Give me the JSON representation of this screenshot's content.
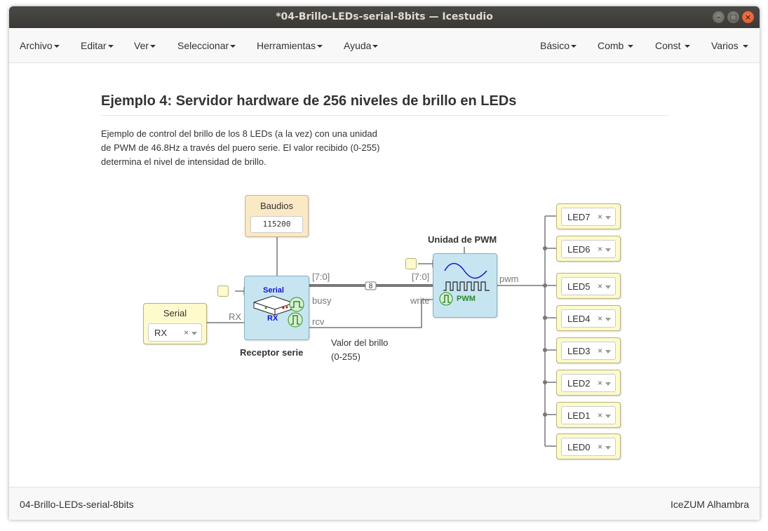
{
  "window": {
    "title": "*04-Brillo-LEDs-serial-8bits — Icestudio",
    "controls": [
      "–",
      "□",
      "×"
    ]
  },
  "menubar": {
    "left": [
      "Archivo",
      "Editar",
      "Ver",
      "Seleccionar",
      "Herramientas",
      "Ayuda"
    ],
    "right": [
      "Básico",
      "Comb",
      "Const",
      "Varios"
    ]
  },
  "canvas": {
    "heading": "Ejemplo 4: Servidor hardware de 256 niveles de brillo en LEDs",
    "description": [
      "Ejemplo de control del brillo de los 8 LEDs (a la vez) con una unidad",
      "de PWM de 46.8Hz a través del puero serie. El valor recibido (0-255)",
      "determina el nivel de intensidad de brillo."
    ],
    "constant": {
      "label": "Baudios",
      "value": "115200"
    },
    "serial_input": {
      "label": "Serial",
      "pin": "RX"
    },
    "receiver": {
      "title": "Serial",
      "subtitle": "RX",
      "caption": "Receptor serie",
      "in_port": "RX",
      "out_ports": {
        "data": "[7:0]",
        "busy": "busy",
        "rcv": "rcv"
      }
    },
    "pwm": {
      "caption": "Unidad de PWM",
      "label": "PWM",
      "in_ports": {
        "data": "[7:0]",
        "write": "write"
      },
      "out_port": "pwm"
    },
    "bus_width": "8",
    "note": [
      "Valor del brillo",
      "(0-255)"
    ],
    "leds": [
      "LED7",
      "LED6",
      "LED5",
      "LED4",
      "LED3",
      "LED2",
      "LED1",
      "LED0"
    ],
    "clear_symbol": "×",
    "colors": {
      "block": "#c7e5f1",
      "io": "#fdfacd",
      "const": "#fbe8c5",
      "wire": "#777777"
    }
  },
  "statusbar": {
    "project": "04-Brillo-LEDs-serial-8bits",
    "board": "IceZUM Alhambra"
  }
}
